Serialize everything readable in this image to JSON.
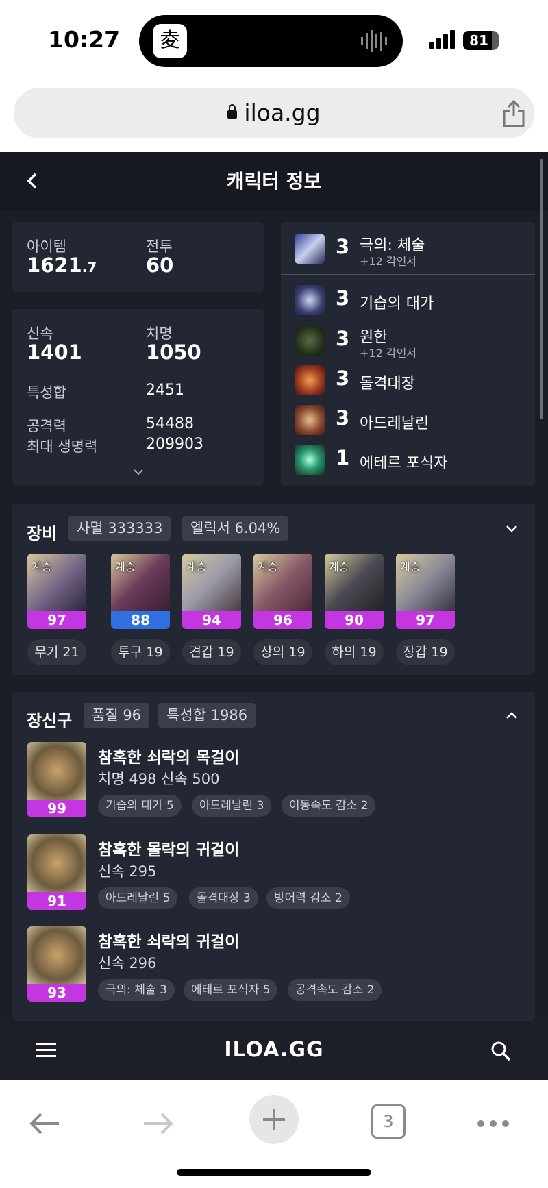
{
  "status": {
    "time": "10:27",
    "battery": "81",
    "battery_level": 0.81
  },
  "browser": {
    "url": "iloa.gg",
    "tab_count": "3"
  },
  "header": {
    "title": "캐릭터 정보"
  },
  "stats": {
    "item_label": "아이템",
    "item_value": "1621",
    "item_decimal": ".7",
    "combat_label": "전투",
    "combat_value": "60",
    "swift_label": "신속",
    "swift_value": "1401",
    "crit_label": "치명",
    "crit_value": "1050",
    "trait_sum_label": "특성합",
    "trait_sum_value": "2451",
    "attack_label": "공격력",
    "attack_value": "54488",
    "hp_label": "최대 생명력",
    "hp_value": "209903"
  },
  "engravings": [
    {
      "level": "3",
      "name": "극의: 체술",
      "sub": "+12 각인서"
    },
    {
      "level": "3",
      "name": "기습의 대가",
      "sub": ""
    },
    {
      "level": "3",
      "name": "원한",
      "sub": "+12 각인서"
    },
    {
      "level": "3",
      "name": "돌격대장",
      "sub": ""
    },
    {
      "level": "3",
      "name": "아드레날린",
      "sub": ""
    },
    {
      "level": "1",
      "name": "에테르 포식자",
      "sub": ""
    }
  ],
  "equipment": {
    "title": "장비",
    "pill1": "사멸 333333",
    "pill2": "엘릭서 6.04%",
    "items": [
      {
        "tag": "계승",
        "quality": "97",
        "name": "무기 21",
        "quality_color": "#c437e0"
      },
      {
        "tag": "계승",
        "quality": "88",
        "name": "투구 19",
        "quality_color": "#2f6fe0"
      },
      {
        "tag": "계승",
        "quality": "94",
        "name": "견갑 19",
        "quality_color": "#c437e0"
      },
      {
        "tag": "계승",
        "quality": "96",
        "name": "상의 19",
        "quality_color": "#c437e0"
      },
      {
        "tag": "계승",
        "quality": "90",
        "name": "하의 19",
        "quality_color": "#c437e0"
      },
      {
        "tag": "계승",
        "quality": "97",
        "name": "장갑 19",
        "quality_color": "#c437e0"
      }
    ]
  },
  "accessories": {
    "title": "장신구",
    "pill1": "품질 96",
    "pill2": "특성합 1986",
    "items": [
      {
        "quality": "99",
        "name": "참혹한 쇠락의 목걸이",
        "stats": "치명 498  신속 500",
        "chips": [
          "기습의 대가 5",
          "아드레날린 3",
          "이동속도 감소 2"
        ]
      },
      {
        "quality": "91",
        "name": "참혹한 몰락의 귀걸이",
        "stats": "신속 295",
        "chips": [
          "아드레날린 5",
          "돌격대장 3",
          "방어력 감소 2"
        ]
      },
      {
        "quality": "93",
        "name": "참혹한 쇠락의 귀걸이",
        "stats": "신속 296",
        "chips": [
          "극의: 체술 3",
          "에테르 포식자 5",
          "공격속도 감소 2"
        ]
      }
    ]
  },
  "bottom": {
    "logo": "ILOA.GG"
  },
  "colors": {
    "accent_purple": "#c437e0",
    "accent_blue": "#2f6fe0",
    "bg": "#1b1e26",
    "card": "#232733"
  }
}
